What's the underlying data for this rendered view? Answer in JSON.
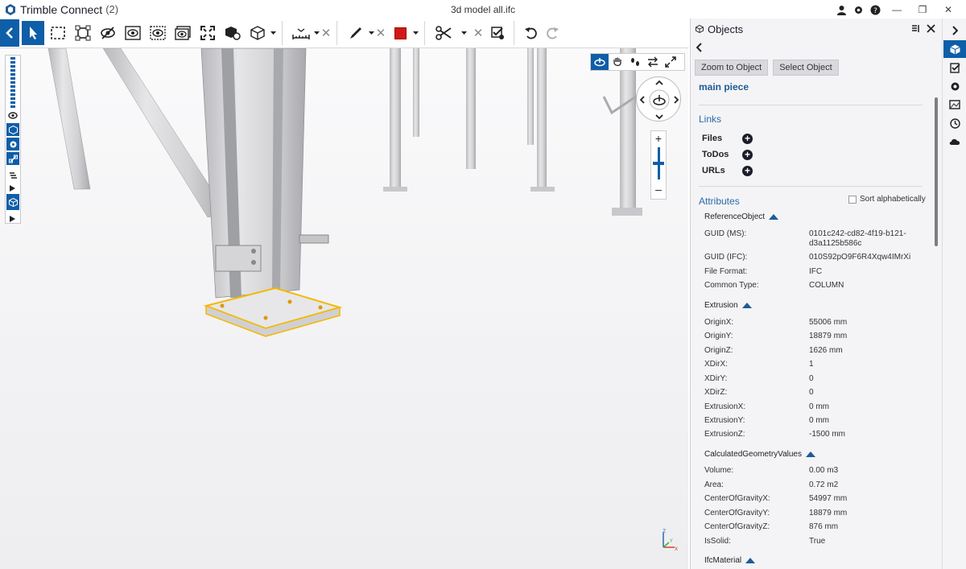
{
  "app": {
    "name": "Trimble Connect",
    "count": "(2)",
    "file_title": "3d model all.ifc"
  },
  "panel": {
    "title": "Objects",
    "zoom_btn": "Zoom to Object",
    "select_btn": "Select Object",
    "object_name": "main piece",
    "links_title": "Links",
    "links": [
      "Files",
      "ToDos",
      "URLs"
    ],
    "attributes_title": "Attributes",
    "sort_label": "Sort alphabetically",
    "groups": {
      "reference": {
        "name": "ReferenceObject",
        "attrs": [
          {
            "k": "GUID (MS):",
            "v1": "0101c242-cd82-4f19-b121-",
            "v2": "d3a1125b586c"
          },
          {
            "k": "GUID (IFC):",
            "v1": "010S92pO9F6R4Xqw4IMrXi"
          },
          {
            "k": "File Format:",
            "v1": "IFC"
          },
          {
            "k": "Common Type:",
            "v1": "COLUMN"
          }
        ]
      },
      "extrusion": {
        "name": "Extrusion",
        "attrs": [
          {
            "k": "OriginX:",
            "v1": "55006 mm"
          },
          {
            "k": "OriginY:",
            "v1": "18879 mm"
          },
          {
            "k": "OriginZ:",
            "v1": "1626 mm"
          },
          {
            "k": "XDirX:",
            "v1": "1"
          },
          {
            "k": "XDirY:",
            "v1": "0"
          },
          {
            "k": "XDirZ:",
            "v1": "0"
          },
          {
            "k": "ExtrusionX:",
            "v1": "0 mm"
          },
          {
            "k": "ExtrusionY:",
            "v1": "0 mm"
          },
          {
            "k": "ExtrusionZ:",
            "v1": "-1500 mm"
          }
        ]
      },
      "calc": {
        "name": "CalculatedGeometryValues",
        "attrs": [
          {
            "k": "Volume:",
            "v1": "0.00 m3"
          },
          {
            "k": "Area:",
            "v1": "0.72 m2"
          },
          {
            "k": "CenterOfGravityX:",
            "v1": "54997 mm"
          },
          {
            "k": "CenterOfGravityY:",
            "v1": "18879 mm"
          },
          {
            "k": "CenterOfGravityZ:",
            "v1": "876 mm"
          },
          {
            "k": "IsSolid:",
            "v1": "True"
          }
        ]
      },
      "material": {
        "name": "IfcMaterial"
      }
    }
  },
  "axis": {
    "z": "Z",
    "x": "X",
    "y": "Y"
  },
  "colors": {
    "accent": "#0e5ea8",
    "selection": "#f5b800",
    "red_swatch": "#d01818"
  }
}
